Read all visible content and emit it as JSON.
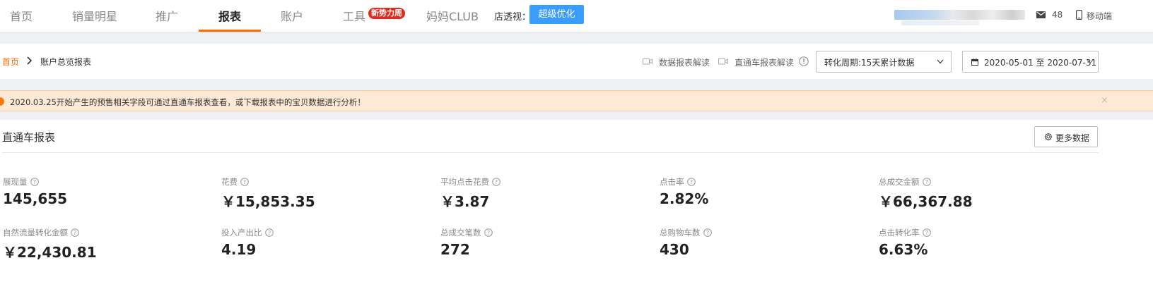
{
  "nav": {
    "items": [
      "首页",
      "销量明星",
      "推广",
      "报表",
      "账户",
      "工具",
      "妈妈CLUB"
    ],
    "badge": "新势力周",
    "shop_label": "店透视：",
    "shop_button": "超级优化",
    "mail_count": "48",
    "mobile_label": "移动端"
  },
  "breadcrumb": {
    "home": "首页",
    "current": "账户总览报表"
  },
  "toolbar": {
    "data_report_guide": "数据报表解读",
    "ztc_report_guide": "直通车报表解读",
    "conversion_period": "转化周期:15天累计数据",
    "date_range": "2020-05-01 至 2020-07-31"
  },
  "notice": {
    "text": "2020.03.25开始产生的预售相关字段可通过直通车报表查看，或下载报表中的宝贝数据进行分析！",
    "close": "×"
  },
  "report": {
    "title": "直通车报表",
    "more_button": "更多数据",
    "metrics": [
      {
        "label": "展现量",
        "value": "145,655"
      },
      {
        "label": "花费",
        "value": "￥15,853.35"
      },
      {
        "label": "平均点击花费",
        "value": "￥3.87"
      },
      {
        "label": "点击率",
        "value": "2.82%"
      },
      {
        "label": "总成交金额",
        "value": "￥66,367.88"
      },
      {
        "label": "自然流量转化金额",
        "value": "￥22,430.81"
      },
      {
        "label": "投入产出比",
        "value": "4.19"
      },
      {
        "label": "总成交笔数",
        "value": "272"
      },
      {
        "label": "总购物车数",
        "value": "430"
      },
      {
        "label": "点击转化率",
        "value": "6.63%"
      }
    ]
  },
  "colors": {
    "accent": "#ff6a00",
    "primary_button": "#3b9cff",
    "notice_bg": "#fde9d6",
    "badge": "#e8261b"
  }
}
